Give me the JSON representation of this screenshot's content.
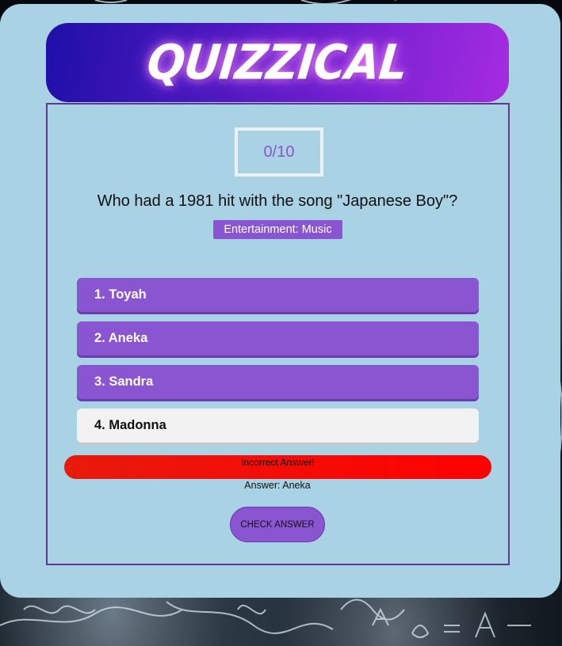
{
  "header": {
    "title": "QUIZZICAL"
  },
  "score": {
    "text": "0/10"
  },
  "question": {
    "text": "Who had a 1981 hit with the song \"Japanese Boy\"?",
    "category": "Entertainment: Music"
  },
  "answers": [
    {
      "label": "1. Toyah",
      "selected": false
    },
    {
      "label": "2. Aneka",
      "selected": false
    },
    {
      "label": "3. Sandra",
      "selected": false
    },
    {
      "label": "4. Madonna",
      "selected": true
    }
  ],
  "result": {
    "message": "Incorrect Answer!",
    "answer_text": "Answer: Aneka",
    "status_color": "#ff0000"
  },
  "actions": {
    "check_label": "CHECK ANSWER"
  },
  "colors": {
    "accent": "#8a55d0",
    "card_background": "#a9d2e4",
    "header_gradient_start": "#1f0fa8",
    "header_gradient_end": "#a62be0"
  }
}
